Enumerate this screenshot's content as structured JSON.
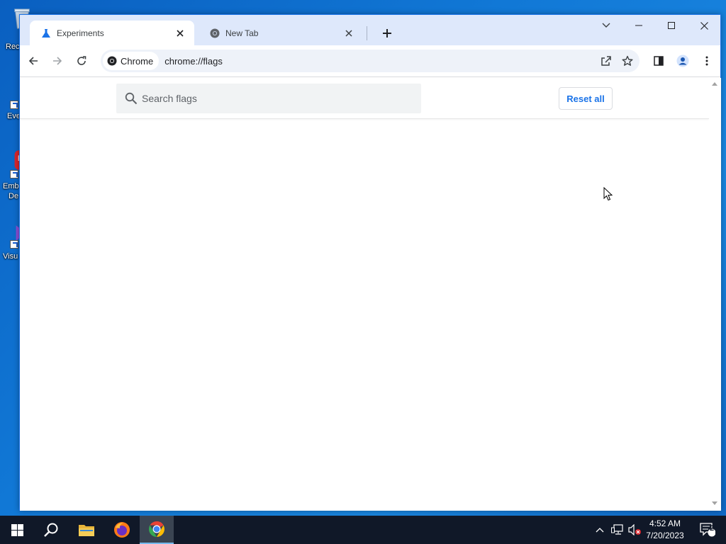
{
  "desktop": {
    "icons": [
      {
        "label": "Rec"
      },
      {
        "label": "Eve"
      },
      {
        "label": "Emb"
      },
      {
        "label": "De"
      },
      {
        "label": "Visu"
      }
    ]
  },
  "browser": {
    "tabs": [
      {
        "title": "Experiments",
        "icon": "flask-icon",
        "active": true
      },
      {
        "title": "New Tab",
        "icon": "chrome-icon",
        "active": false
      }
    ],
    "omnibox": {
      "chip_label": "Chrome",
      "url": "chrome://flags"
    }
  },
  "flags_page": {
    "search_placeholder": "Search flags",
    "reset_button": "Reset all"
  },
  "taskbar": {
    "clock_time": "4:52 AM",
    "clock_date": "7/20/2023",
    "notification_count": "2"
  },
  "colors": {
    "accent": "#1a73e8",
    "tabstrip": "#dee8fb",
    "taskbar": "#101828"
  }
}
